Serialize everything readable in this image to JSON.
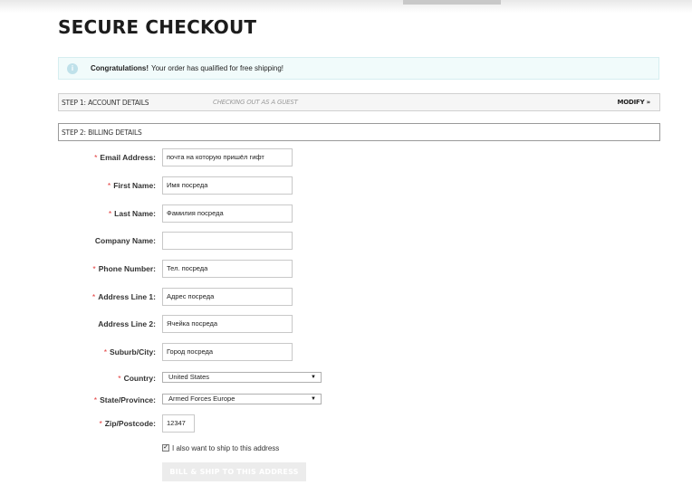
{
  "page_title": "SECURE CHECKOUT",
  "notice": {
    "strong": "Congratulations!",
    "text": "Your order has qualified for free shipping!",
    "icon": "info-icon"
  },
  "step1": {
    "title": "STEP 1: ACCOUNT DETAILS",
    "subtitle": "CHECKING OUT AS A GUEST",
    "modify": "MODIFY »"
  },
  "step2": {
    "title": "STEP 2: BILLING DETAILS"
  },
  "form": {
    "email": {
      "label": "Email Address:",
      "required": "*",
      "value": "почта на которую пришёл гифт"
    },
    "first_name": {
      "label": "First Name:",
      "required": "*",
      "value": "Имя посреда"
    },
    "last_name": {
      "label": "Last Name:",
      "required": "*",
      "value": "Фамилия посреда"
    },
    "company": {
      "label": "Company Name:",
      "value": ""
    },
    "phone": {
      "label": "Phone Number:",
      "required": "*",
      "value": "Тел. посреда"
    },
    "address1": {
      "label": "Address Line 1:",
      "required": "*",
      "value": "Адрес посреда"
    },
    "address2": {
      "label": "Address Line 2:",
      "value": "Ячейка посреда"
    },
    "city": {
      "label": "Suburb/City:",
      "required": "*",
      "value": "Город посреда"
    },
    "country": {
      "label": "Country:",
      "required": "*",
      "value": "United States"
    },
    "state": {
      "label": "State/Province:",
      "required": "*",
      "value": "Armed Forces Europe"
    },
    "zip": {
      "label": "Zip/Postcode:",
      "required": "*",
      "value": "12347"
    }
  },
  "ship_checkbox": {
    "label": "I also want to ship to this address",
    "checked": true
  },
  "submit_label": "BILL & SHIP TO THIS ADDRESS",
  "colors": {
    "required": "#e23b3b",
    "notice_bg": "#f1fbfb"
  }
}
